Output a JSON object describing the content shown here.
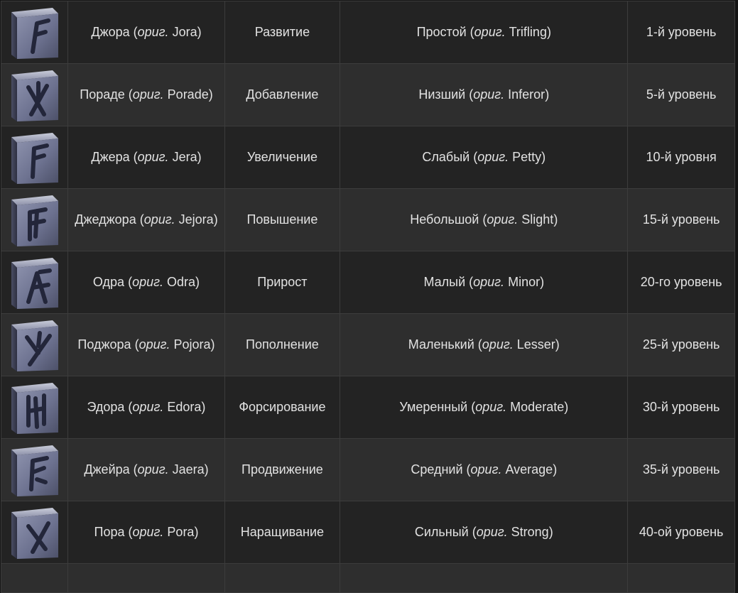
{
  "table": {
    "rows": [
      {
        "icon": "rune-jora-icon",
        "name": "Джора",
        "orig_word": "ориг.",
        "orig_name": "Jora",
        "effect": "Развитие",
        "tier": "Простой",
        "orig_tier": "Trifling",
        "level": "1-й уровень"
      },
      {
        "icon": "rune-porade-icon",
        "name": "Пораде",
        "orig_word": "ориг.",
        "orig_name": "Porade",
        "effect": "Добавление",
        "tier": "Низший",
        "orig_tier": "Inferor",
        "level": "5-й уровень"
      },
      {
        "icon": "rune-jera-icon",
        "name": "Джера",
        "orig_word": "ориг.",
        "orig_name": "Jera",
        "effect": "Увеличение",
        "tier": "Слабый",
        "orig_tier": "Petty",
        "level": "10-й уровня"
      },
      {
        "icon": "rune-jejora-icon",
        "name": "Джеджора",
        "orig_word": "ориг.",
        "orig_name": "Jejora",
        "effect": "Повышение",
        "tier": "Небольшой",
        "orig_tier": "Slight",
        "level": "15-й уровень"
      },
      {
        "icon": "rune-odra-icon",
        "name": "Одра",
        "orig_word": "ориг.",
        "orig_name": "Odra",
        "effect": "Прирост",
        "tier": "Малый",
        "orig_tier": "Minor",
        "level": "20-го уровень"
      },
      {
        "icon": "rune-pojora-icon",
        "name": "Поджора",
        "orig_word": "ориг.",
        "orig_name": "Pojora",
        "effect": "Пополнение",
        "tier": "Маленький",
        "orig_tier": "Lesser",
        "level": "25-й уровень"
      },
      {
        "icon": "rune-edora-icon",
        "name": "Эдора",
        "orig_word": "ориг.",
        "orig_name": "Edora",
        "effect": "Форсирование",
        "tier": "Умеренный",
        "orig_tier": "Moderate",
        "level": "30-й уровень"
      },
      {
        "icon": "rune-jaera-icon",
        "name": "Джейра",
        "orig_word": "ориг.",
        "orig_name": "Jaera",
        "effect": "Продвижение",
        "tier": "Средний",
        "orig_tier": "Average",
        "level": "35-й уровень"
      },
      {
        "icon": "rune-pora-icon",
        "name": "Пора",
        "orig_word": "ориг.",
        "orig_name": "Pora",
        "effect": "Наращивание",
        "tier": "Сильный",
        "orig_tier": "Strong",
        "level": "40-ой уровень"
      }
    ]
  },
  "colors": {
    "row_dark": "#232323",
    "row_light": "#2e2e2e",
    "border": "#3c3c3c",
    "text": "#e2e2e2",
    "stone": "#7a7f9a",
    "glyph": "#23263a"
  }
}
